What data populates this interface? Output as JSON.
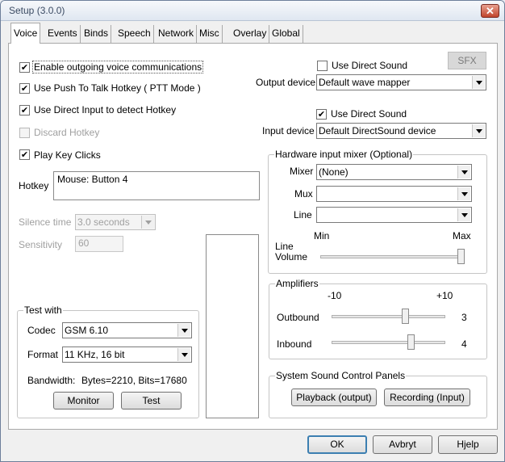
{
  "window": {
    "title": "Setup (3.0.0)",
    "close_label": "✕"
  },
  "tabs": [
    "Voice",
    "Events",
    "Binds",
    "Speech",
    "Network",
    "Misc",
    "Overlay",
    "Global"
  ],
  "voice": {
    "enable_outgoing": {
      "label": "Enable outgoing voice communications",
      "checked": true
    },
    "push_to_talk": {
      "label": "Use Push To Talk Hotkey ( PTT Mode )",
      "checked": true
    },
    "direct_input": {
      "label": "Use Direct Input to detect Hotkey",
      "checked": true
    },
    "discard_hotkey": {
      "label": "Discard Hotkey",
      "checked": false,
      "disabled": true
    },
    "play_key_clicks": {
      "label": "Play Key Clicks",
      "checked": true
    },
    "hotkey": {
      "label": "Hotkey",
      "value": "Mouse: Button 4"
    },
    "silence_time": {
      "label": "Silence time",
      "value": "3.0 seconds"
    },
    "sensitivity": {
      "label": "Sensitivity",
      "value": "60"
    }
  },
  "test_with": {
    "legend": "Test with",
    "codec_label": "Codec",
    "codec_value": "GSM 6.10",
    "format_label": "Format",
    "format_value": "11 KHz, 16 bit",
    "bandwidth_label": "Bandwidth:",
    "bandwidth_value": "Bytes=2210, Bits=17680",
    "monitor_label": "Monitor",
    "test_label": "Test"
  },
  "output": {
    "sfx_label": "SFX",
    "use_direct_sound": {
      "label": "Use Direct Sound",
      "checked": false
    },
    "device_label": "Output device",
    "device_value": "Default wave mapper"
  },
  "input": {
    "use_direct_sound": {
      "label": "Use Direct Sound",
      "checked": true
    },
    "device_label": "Input device",
    "device_value": "Default DirectSound device"
  },
  "mixer": {
    "legend": "Hardware input mixer (Optional)",
    "mixer_label": "Mixer",
    "mixer_value": "(None)",
    "mux_label": "Mux",
    "mux_value": "",
    "line_label": "Line",
    "line_value": "",
    "min_label": "Min",
    "max_label": "Max",
    "line_volume_label_1": "Line",
    "line_volume_label_2": "Volume",
    "line_volume_level": 1.0
  },
  "amplifiers": {
    "legend": "Amplifiers",
    "min_label": "-10",
    "max_label": "+10",
    "outbound_label": "Outbound",
    "outbound_value": "3",
    "inbound_label": "Inbound",
    "inbound_value": "4"
  },
  "sound_panels": {
    "legend": "System Sound Control Panels",
    "playback_label": "Playback (output)",
    "recording_label": "Recording (Input)"
  },
  "footer": {
    "ok_label": "OK",
    "cancel_label": "Avbryt",
    "help_label": "Hjelp"
  }
}
